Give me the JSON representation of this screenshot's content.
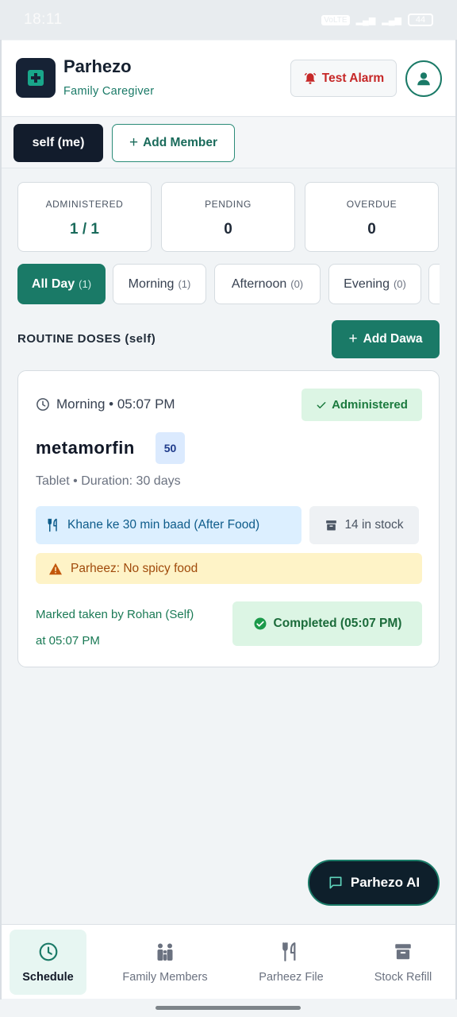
{
  "statusbar": {
    "time": "18:11",
    "net_chip": "VoLTE",
    "battery": "44"
  },
  "header": {
    "title": "Parhezo",
    "subtitle": "Family Caregiver",
    "test_alarm_label": "Test Alarm"
  },
  "members": {
    "active": "self (me)",
    "add_label": "Add Member"
  },
  "stats": [
    {
      "label": "ADMINISTERED",
      "value": "1 / 1"
    },
    {
      "label": "PENDING",
      "value": "0"
    },
    {
      "label": "OVERDUE",
      "value": "0"
    }
  ],
  "tabs": [
    {
      "label": "All Day",
      "count": "(1)"
    },
    {
      "label": "Morning",
      "count": "(1)"
    },
    {
      "label": "Afternoon",
      "count": "(0)"
    },
    {
      "label": "Evening",
      "count": "(0)"
    }
  ],
  "section": {
    "title": "ROUTINE DOSES (self)",
    "add_label": "Add Dawa"
  },
  "dose": {
    "time": "Morning • 05:07 PM",
    "status": "Administered",
    "name": "metamorfin",
    "strength": "50",
    "meta": "Tablet • Duration: 30 days",
    "food": "Khane ke 30 min baad (After Food)",
    "stock": "14 in stock",
    "parheez": "Parheez: No spicy food",
    "marked_line1": "Marked taken by Rohan (Self)",
    "marked_line2": "at 05:07 PM",
    "completed": "Completed (05:07 PM)"
  },
  "ai_button": "Parhezo AI",
  "nav": [
    {
      "label": "Schedule",
      "icon": "clock-icon"
    },
    {
      "label": "Family Members",
      "icon": "family-icon"
    },
    {
      "label": "Parheez File",
      "icon": "utensils-icon"
    },
    {
      "label": "Stock Refill",
      "icon": "archive-icon"
    }
  ],
  "colors": {
    "primary": "#1a7a67",
    "dark": "#121c2c",
    "alarm": "#c62828",
    "success_bg": "#dcf5e4",
    "warning_bg": "#fef3c7",
    "info_bg": "#dcefff"
  }
}
